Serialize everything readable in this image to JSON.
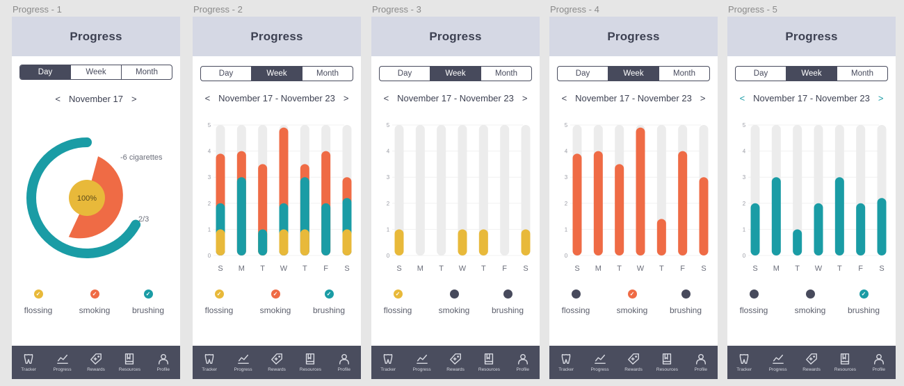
{
  "colors": {
    "flossing": "#e8b93a",
    "smoking": "#ef6b45",
    "brushing": "#1a9ca5",
    "inactive": "#474a5c",
    "track": "#ececec",
    "navbar": "#4a4d5e",
    "header": "#d5d8e4"
  },
  "screens": [
    {
      "frame_label": "Progress - 1",
      "title": "Progress",
      "tabs": [
        "Day",
        "Week",
        "Month"
      ],
      "active_tab": 0,
      "date": "November 17",
      "teal_arrows": false,
      "chart_data": {
        "type": "donut",
        "center_label": "100%",
        "smoking_label": "-6 cigarettes",
        "brushing_label": "2/3",
        "flossing_fraction": 1.0,
        "smoking_fraction": 0.5,
        "brushing_fraction": 0.67
      },
      "legend": [
        {
          "label": "flossing",
          "color": "flossing",
          "checked": true
        },
        {
          "label": "smoking",
          "color": "smoking",
          "checked": true
        },
        {
          "label": "brushing",
          "color": "brushing",
          "checked": true
        }
      ]
    },
    {
      "frame_label": "Progress - 2",
      "title": "Progress",
      "tabs": [
        "Day",
        "Week",
        "Month"
      ],
      "active_tab": 1,
      "date": "November 17 - November 23",
      "teal_arrows": false,
      "chart_data": {
        "type": "bar",
        "categories": [
          "S",
          "M",
          "T",
          "W",
          "T",
          "F",
          "S"
        ],
        "y_ticks": [
          "0",
          "1",
          "2",
          "3",
          "4",
          "5"
        ],
        "ylim": [
          0,
          5
        ],
        "series": [
          {
            "key": "flossing",
            "values": [
              1,
              0,
              1,
              1,
              1,
              0,
              1
            ]
          },
          {
            "key": "brushing",
            "values": [
              2,
              3,
              1,
              2,
              3,
              2,
              2.2
            ]
          },
          {
            "key": "smoking",
            "values": [
              3.9,
              4,
              3.5,
              4.9,
              3.5,
              4,
              3
            ]
          }
        ],
        "mode": "overlay"
      },
      "legend": [
        {
          "label": "flossing",
          "color": "flossing",
          "checked": true
        },
        {
          "label": "smoking",
          "color": "smoking",
          "checked": true
        },
        {
          "label": "brushing",
          "color": "brushing",
          "checked": true
        }
      ]
    },
    {
      "frame_label": "Progress - 3",
      "title": "Progress",
      "tabs": [
        "Day",
        "Week",
        "Month"
      ],
      "active_tab": 1,
      "date": "November 17 - November 23",
      "teal_arrows": false,
      "chart_data": {
        "type": "bar",
        "categories": [
          "S",
          "M",
          "T",
          "W",
          "T",
          "F",
          "S"
        ],
        "y_ticks": [
          "0",
          "1",
          "2",
          "3",
          "4",
          "5"
        ],
        "ylim": [
          0,
          5
        ],
        "series": [
          {
            "key": "flossing",
            "values": [
              1,
              0,
              0,
              1,
              1,
              0,
              1
            ]
          }
        ],
        "mode": "overlay"
      },
      "legend": [
        {
          "label": "flossing",
          "color": "flossing",
          "checked": true
        },
        {
          "label": "smoking",
          "color": "inactive",
          "checked": false
        },
        {
          "label": "brushing",
          "color": "inactive",
          "checked": false
        }
      ]
    },
    {
      "frame_label": "Progress - 4",
      "title": "Progress",
      "tabs": [
        "Day",
        "Week",
        "Month"
      ],
      "active_tab": 1,
      "date": "November 17 - November 23",
      "teal_arrows": false,
      "chart_data": {
        "type": "bar",
        "categories": [
          "S",
          "M",
          "T",
          "W",
          "T",
          "F",
          "S"
        ],
        "y_ticks": [
          "0",
          "1",
          "2",
          "3",
          "4",
          "5"
        ],
        "ylim": [
          0,
          5
        ],
        "series": [
          {
            "key": "smoking",
            "values": [
              3.9,
              4,
              3.5,
              4.9,
              1.4,
              4,
              3
            ]
          }
        ],
        "mode": "overlay"
      },
      "legend": [
        {
          "label": "flossing",
          "color": "inactive",
          "checked": false
        },
        {
          "label": "smoking",
          "color": "smoking",
          "checked": true
        },
        {
          "label": "brushing",
          "color": "inactive",
          "checked": false
        }
      ]
    },
    {
      "frame_label": "Progress - 5",
      "title": "Progress",
      "tabs": [
        "Day",
        "Week",
        "Month"
      ],
      "active_tab": 1,
      "date": "November 17 - November 23",
      "teal_arrows": true,
      "chart_data": {
        "type": "bar",
        "categories": [
          "S",
          "M",
          "T",
          "W",
          "T",
          "F",
          "S"
        ],
        "y_ticks": [
          "0",
          "1",
          "2",
          "3",
          "4",
          "5"
        ],
        "ylim": [
          0,
          5
        ],
        "series": [
          {
            "key": "brushing",
            "values": [
              2,
              3,
              1,
              2,
              3,
              2,
              2.2
            ]
          }
        ],
        "mode": "overlay"
      },
      "legend": [
        {
          "label": "flossing",
          "color": "inactive",
          "checked": false
        },
        {
          "label": "smoking",
          "color": "inactive",
          "checked": false
        },
        {
          "label": "brushing",
          "color": "brushing",
          "checked": true
        }
      ]
    }
  ],
  "nav": [
    {
      "label": "Tracker",
      "icon": "tooth-icon"
    },
    {
      "label": "Progress",
      "icon": "chart-line-icon"
    },
    {
      "label": "Rewards",
      "icon": "tag-icon"
    },
    {
      "label": "Resources",
      "icon": "book-icon"
    },
    {
      "label": "Profile",
      "icon": "person-icon"
    }
  ]
}
